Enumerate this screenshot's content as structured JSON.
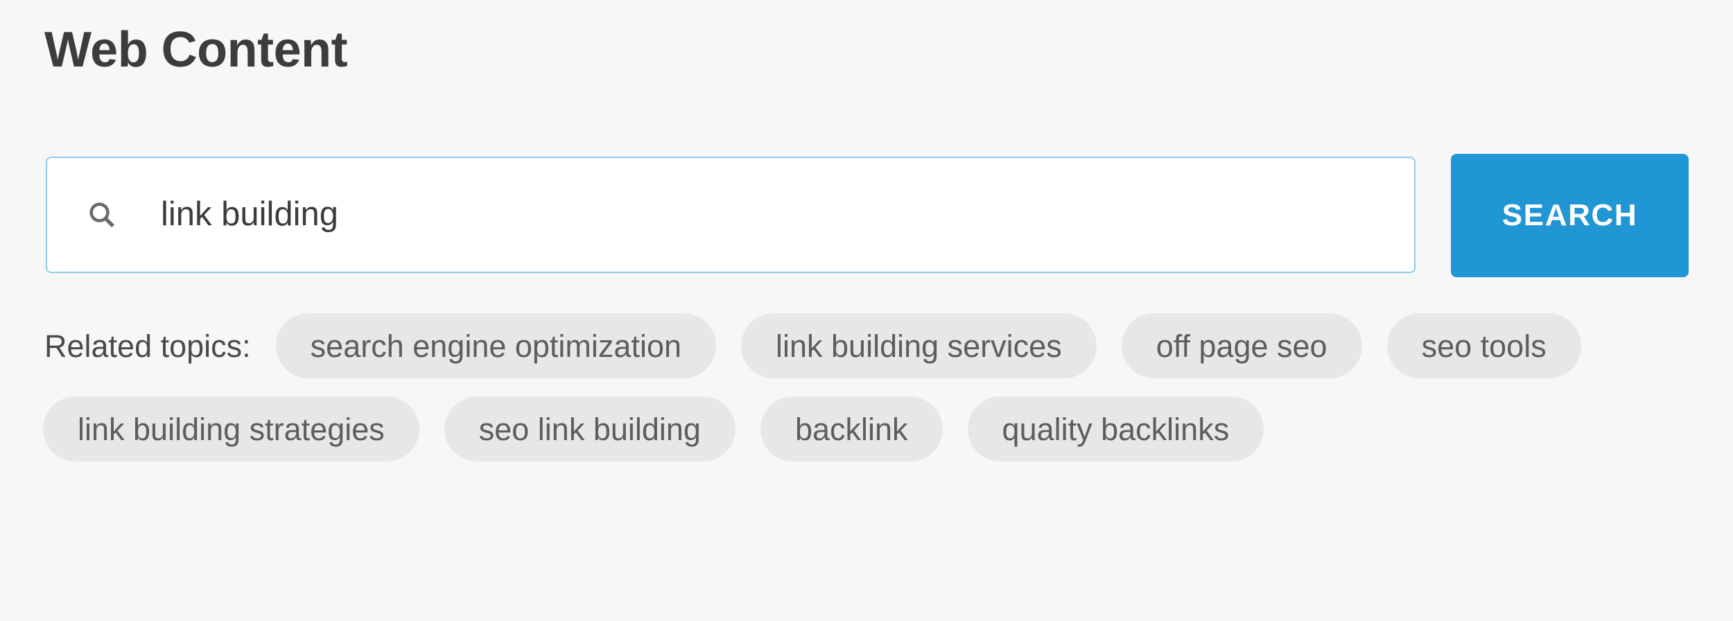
{
  "header": {
    "title": "Web Content"
  },
  "search": {
    "value": "link building",
    "placeholder": "",
    "icon": "search-icon",
    "button_label": "SEARCH",
    "accent_color": "#2196d4",
    "border_color": "#8fcaea"
  },
  "related_topics": {
    "label": "Related topics:",
    "chip_background": "#e7e7e7",
    "chip_text_color": "#5d5d5d",
    "items": [
      {
        "label": "search engine optimization"
      },
      {
        "label": "link building services"
      },
      {
        "label": "off page seo"
      },
      {
        "label": "seo tools"
      },
      {
        "label": "link building strategies"
      },
      {
        "label": "seo link building"
      },
      {
        "label": "backlink"
      },
      {
        "label": "quality backlinks"
      }
    ]
  },
  "theme": {
    "page_background": "#f7f7f7",
    "title_color": "#3c3c3c",
    "text_color": "#4a4a4a"
  }
}
